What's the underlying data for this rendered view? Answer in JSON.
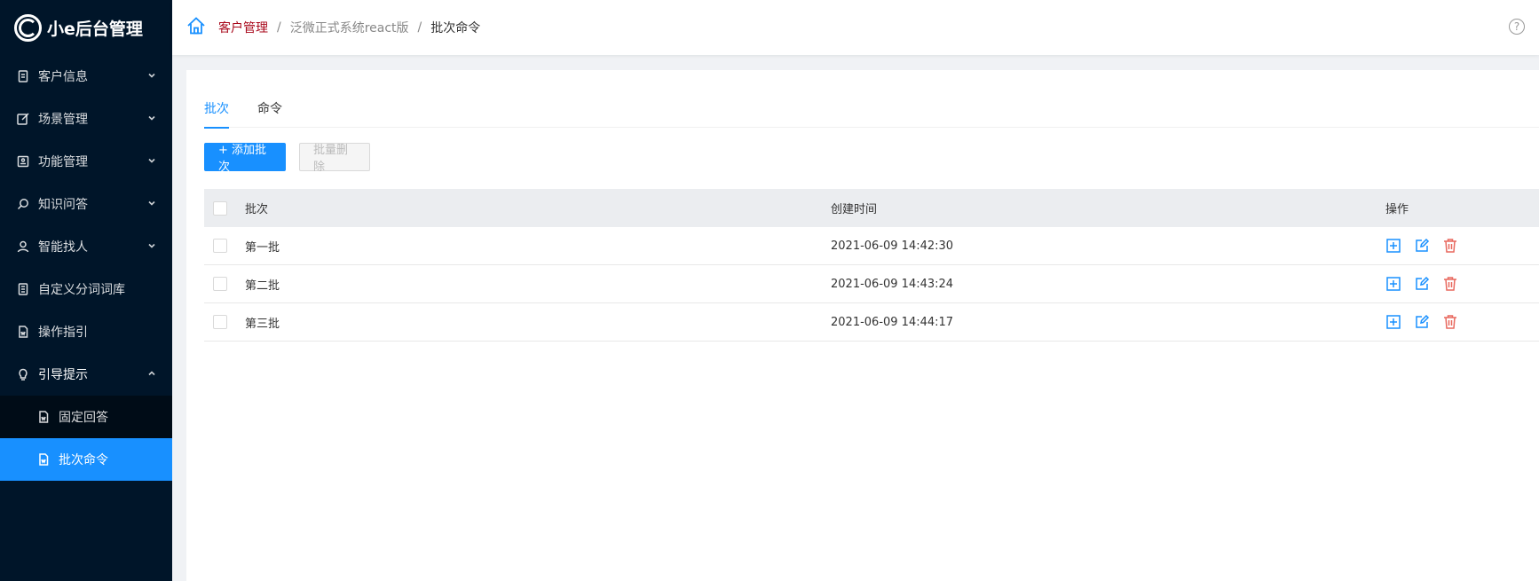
{
  "app": {
    "title": "小e后台管理"
  },
  "sidebar": {
    "items": [
      {
        "label": "客户信息",
        "icon": "document-icon",
        "has_arrow": true
      },
      {
        "label": "场景管理",
        "icon": "edit-icon",
        "has_arrow": true
      },
      {
        "label": "功能管理",
        "icon": "screen-icon",
        "has_arrow": true
      },
      {
        "label": "知识问答",
        "icon": "search-icon",
        "has_arrow": true
      },
      {
        "label": "智能找人",
        "icon": "user-icon",
        "has_arrow": true
      },
      {
        "label": "自定义分词词库",
        "icon": "book-icon",
        "has_arrow": false
      },
      {
        "label": "操作指引",
        "icon": "file-icon",
        "has_arrow": false
      },
      {
        "label": "引导提示",
        "icon": "bulb-icon",
        "has_arrow": true,
        "open": true
      }
    ],
    "submenu": [
      {
        "label": "固定回答",
        "icon": "file-icon"
      },
      {
        "label": "批次命令",
        "icon": "file-icon",
        "active": true
      }
    ]
  },
  "header": {
    "breadcrumb": [
      "客户管理",
      "泛微正式系统react版",
      "批次命令"
    ],
    "separator": "/",
    "help": "?"
  },
  "tabs": [
    {
      "label": "批次",
      "active": true
    },
    {
      "label": "命令",
      "active": false
    }
  ],
  "toolbar": {
    "add_label": "+ 添加批次",
    "delete_label": "批量删除"
  },
  "table": {
    "columns": [
      "批次",
      "创建时间",
      "操作"
    ],
    "rows": [
      {
        "batch": "第一批",
        "created": "2021-06-09 14:42:30"
      },
      {
        "batch": "第二批",
        "created": "2021-06-09 14:43:24"
      },
      {
        "batch": "第三批",
        "created": "2021-06-09 14:44:17"
      }
    ]
  },
  "colors": {
    "sidebar_bg": "#001529",
    "primary": "#1890ff",
    "danger": "#e8685e",
    "breadcrumb_active": "#a8071a"
  }
}
